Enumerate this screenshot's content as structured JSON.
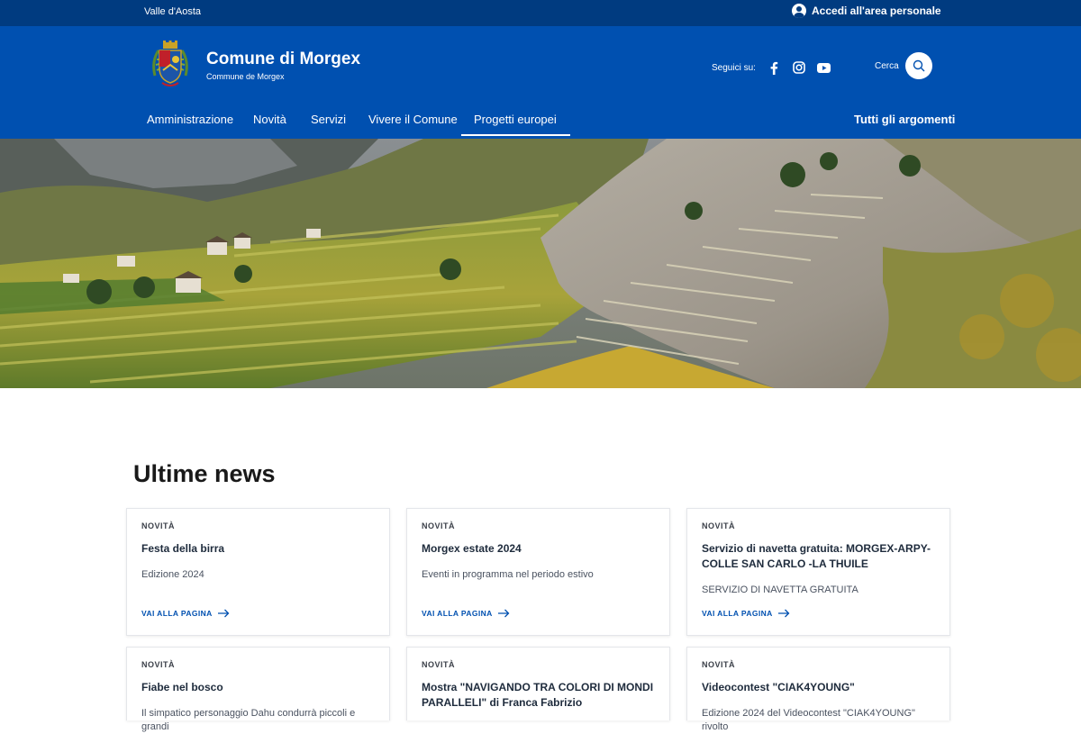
{
  "topbar": {
    "region": "Valle d'Aosta",
    "login_label": "Accedi all'area personale"
  },
  "header": {
    "title": "Comune di Morgex",
    "subtitle": "Commune de Morgex",
    "social_label": "Seguici su:",
    "search_label": "Cerca"
  },
  "nav": {
    "items": [
      "Amministrazione",
      "Novità",
      "Servizi",
      "Vivere il Comune",
      "Progetti europei"
    ],
    "all_topics": "Tutti gli argomenti"
  },
  "news": {
    "title": "Ultime news",
    "cards": [
      {
        "category": "NOVITÀ",
        "title": "Festa della birra",
        "description": "Edizione 2024",
        "link": "VAI ALLA PAGINA"
      },
      {
        "category": "NOVITÀ",
        "title": "Morgex estate 2024",
        "description": "Eventi in programma nel periodo estivo",
        "link": "VAI ALLA PAGINA"
      },
      {
        "category": "NOVITÀ",
        "title": "Servizio di navetta gratuita: MORGEX-ARPY-COLLE SAN CARLO -LA THUILE",
        "description": "SERVIZIO DI NAVETTA GRATUITA",
        "link": "VAI ALLA PAGINA"
      },
      {
        "category": "NOVITÀ",
        "title": "Fiabe nel bosco",
        "description": "Il simpatico personaggio Dahu condurrà piccoli e grandi"
      },
      {
        "category": "NOVITÀ",
        "title": "Mostra \"NAVIGANDO TRA COLORI DI MONDI PARALLELI\" di Franca Fabrizio",
        "description": ""
      },
      {
        "category": "NOVITÀ",
        "title": "Videocontest \"CIAK4YOUNG\"",
        "description": "Edizione 2024 del Videocontest \"CIAK4YOUNG\" rivolto"
      }
    ]
  },
  "colors": {
    "topbar": "#003b80",
    "header": "#0050b0",
    "link": "#0050b0",
    "heading": "#191919"
  }
}
